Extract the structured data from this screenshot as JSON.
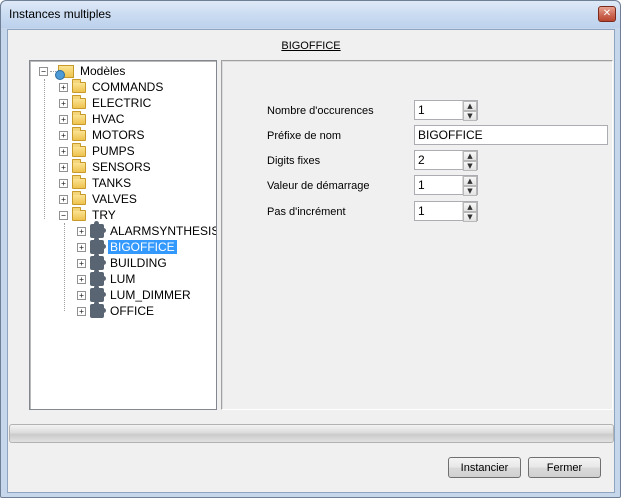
{
  "window": {
    "title": "Instances multiples",
    "close_glyph": "✕"
  },
  "header": {
    "title": "BIGOFFICE"
  },
  "tree": {
    "root": {
      "label": "Modèles",
      "expander": "−",
      "icon": "models-root-icon"
    },
    "folders": [
      {
        "label": "COMMANDS",
        "expander": "+"
      },
      {
        "label": "ELECTRIC",
        "expander": "+"
      },
      {
        "label": "HVAC",
        "expander": "+"
      },
      {
        "label": "MOTORS",
        "expander": "+"
      },
      {
        "label": "PUMPS",
        "expander": "+"
      },
      {
        "label": "SENSORS",
        "expander": "+"
      },
      {
        "label": "TANKS",
        "expander": "+"
      },
      {
        "label": "VALVES",
        "expander": "+"
      },
      {
        "label": "TRY",
        "expander": "−"
      }
    ],
    "models": [
      {
        "label": "ALARMSYNTHESIS",
        "expander": "+",
        "selected": false
      },
      {
        "label": "BIGOFFICE",
        "expander": "+",
        "selected": true
      },
      {
        "label": "BUILDING",
        "expander": "+",
        "selected": false
      },
      {
        "label": "LUM",
        "expander": "+",
        "selected": false
      },
      {
        "label": "LUM_DIMMER",
        "expander": "+",
        "selected": false
      },
      {
        "label": "OFFICE",
        "expander": "+",
        "selected": false
      }
    ]
  },
  "form": {
    "occurrences": {
      "label": "Nombre d'occurences",
      "value": "1"
    },
    "prefix": {
      "label": "Préfixe de nom",
      "value": "BIGOFFICE"
    },
    "digits": {
      "label": "Digits fixes",
      "value": "2"
    },
    "start": {
      "label": "Valeur de démarrage",
      "value": "1"
    },
    "step": {
      "label": "Pas d'incrément",
      "value": "1"
    },
    "spin_up": "▲",
    "spin_down": "▼"
  },
  "progress": {
    "value": 0,
    "colors": {
      "track": "#dcdcdc",
      "fill": "#37c024"
    }
  },
  "buttons": {
    "instantiate": "Instancier",
    "close": "Fermer"
  },
  "colors": {
    "frame": "#c6d7ec",
    "selection": "#3399ff",
    "close_button": "#cf6e5a"
  }
}
